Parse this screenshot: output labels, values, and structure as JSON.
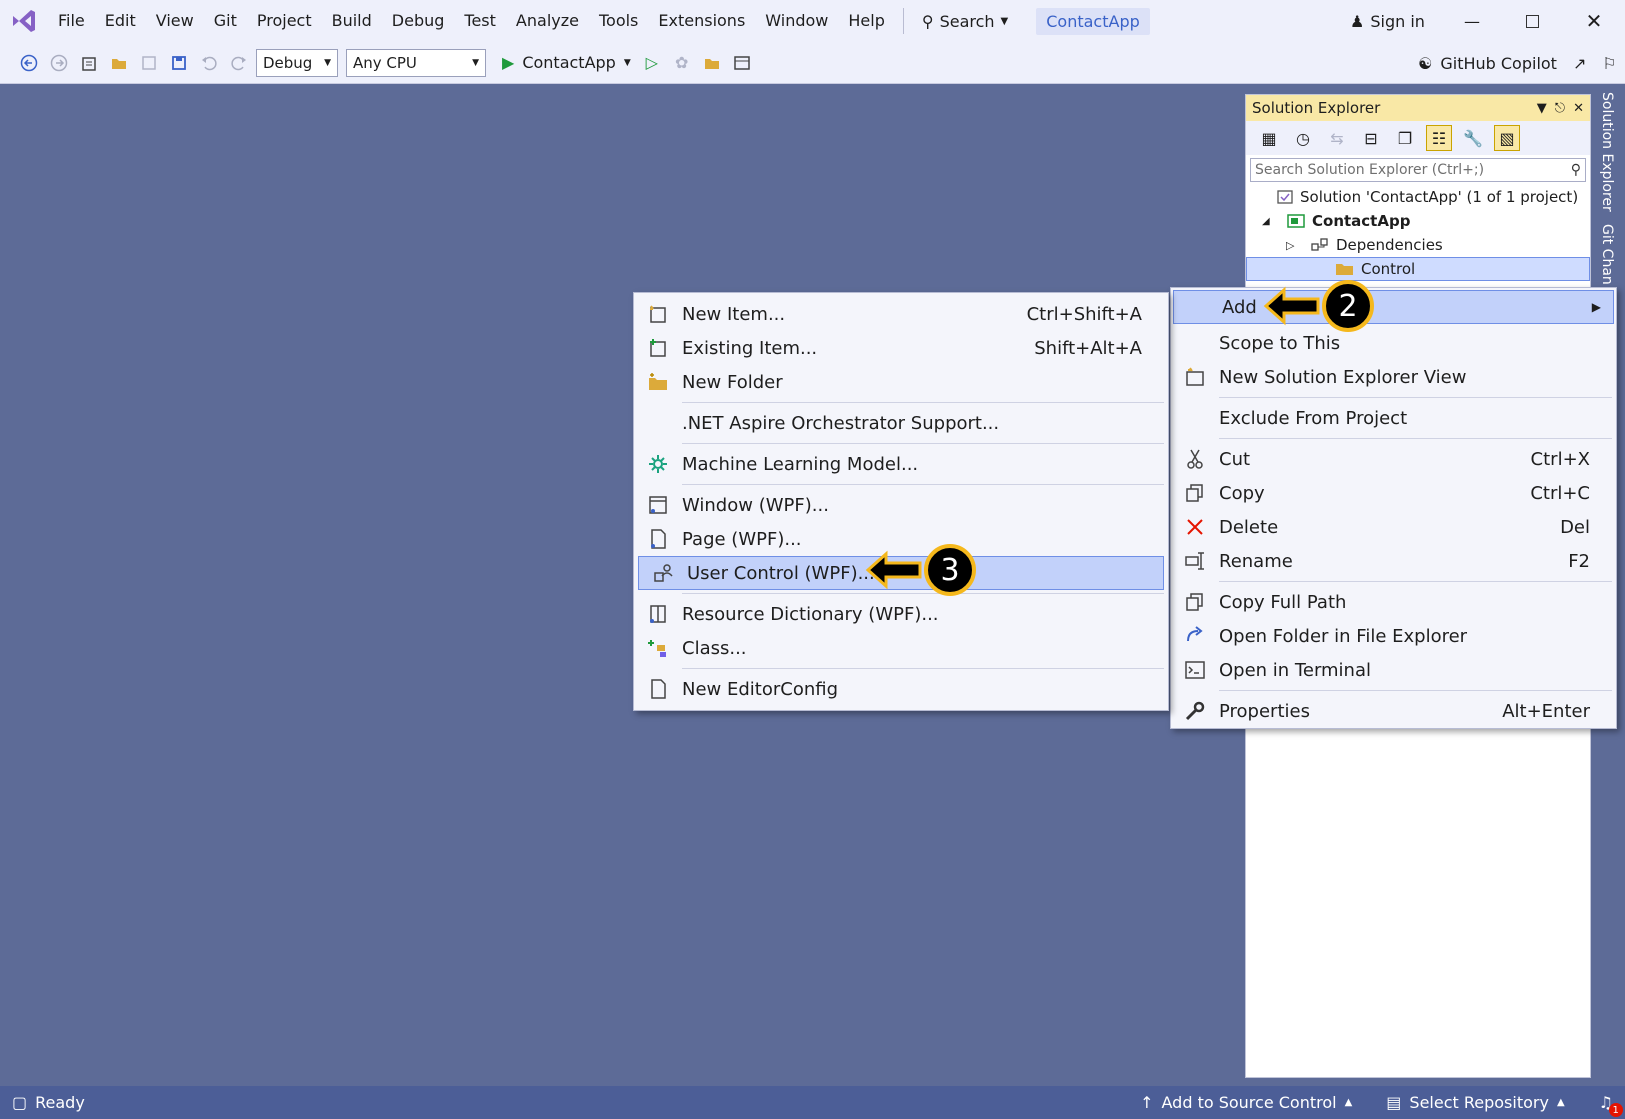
{
  "menubar": {
    "items": [
      "File",
      "Edit",
      "View",
      "Git",
      "Project",
      "Build",
      "Debug",
      "Test",
      "Analyze",
      "Tools",
      "Extensions",
      "Window",
      "Help"
    ],
    "search_label": "Search",
    "title": "ContactApp",
    "signin_label": "Sign in"
  },
  "toolbar": {
    "config": "Debug",
    "platform": "Any CPU",
    "run_label": "ContactApp",
    "copilot_label": "GitHub Copilot"
  },
  "solution_explorer": {
    "title": "Solution Explorer",
    "search_placeholder": "Search Solution Explorer (Ctrl+;)",
    "tree": [
      {
        "label": "Solution 'ContactApp' (1 of 1 project)",
        "depth": 0,
        "bold": false
      },
      {
        "label": "ContactApp",
        "depth": 1,
        "bold": true
      },
      {
        "label": "Dependencies",
        "depth": 2,
        "bold": false
      },
      {
        "label": "Control",
        "depth": 3,
        "bold": false
      }
    ]
  },
  "side_tabs": [
    "Solution Explorer",
    "Git Chan"
  ],
  "folder_menu": {
    "add": {
      "label": "Add",
      "highlighted": true
    },
    "items": [
      {
        "label": "Scope to This",
        "shortcut": "",
        "icon": "none"
      },
      {
        "label": "New Solution Explorer View",
        "shortcut": "",
        "icon": "new-view-icon"
      },
      {
        "sep": true
      },
      {
        "label": "Exclude From Project",
        "shortcut": "",
        "icon": "none"
      },
      {
        "sep": true
      },
      {
        "label": "Cut",
        "shortcut": "Ctrl+X",
        "icon": "scissors-icon"
      },
      {
        "label": "Copy",
        "shortcut": "Ctrl+C",
        "icon": "copy-icon"
      },
      {
        "label": "Delete",
        "shortcut": "Del",
        "icon": "delete-icon"
      },
      {
        "label": "Rename",
        "shortcut": "F2",
        "icon": "rename-icon"
      },
      {
        "sep": true
      },
      {
        "label": "Copy Full Path",
        "shortcut": "",
        "icon": "copy-icon"
      },
      {
        "label": "Open Folder in File Explorer",
        "shortcut": "",
        "icon": "open-folder-arrow-icon"
      },
      {
        "label": "Open in Terminal",
        "shortcut": "",
        "icon": "terminal-icon"
      },
      {
        "sep": true
      },
      {
        "label": "Properties",
        "shortcut": "Alt+Enter",
        "icon": "wrench-icon"
      }
    ]
  },
  "add_menu": {
    "items": [
      {
        "label": "New Item...",
        "shortcut": "Ctrl+Shift+A",
        "icon": "new-item-icon"
      },
      {
        "label": "Existing Item...",
        "shortcut": "Shift+Alt+A",
        "icon": "existing-item-icon"
      },
      {
        "label": "New Folder",
        "shortcut": "",
        "icon": "new-folder-icon"
      },
      {
        "sep": true
      },
      {
        "label": ".NET Aspire Orchestrator Support...",
        "shortcut": "",
        "icon": "none"
      },
      {
        "sep": true
      },
      {
        "label": "Machine Learning Model...",
        "shortcut": "",
        "icon": "ml-model-icon"
      },
      {
        "sep": true
      },
      {
        "label": "Window (WPF)...",
        "shortcut": "",
        "icon": "window-icon"
      },
      {
        "label": "Page (WPF)...",
        "shortcut": "",
        "icon": "page-icon"
      },
      {
        "label": "User Control (WPF)...",
        "shortcut": "",
        "icon": "user-control-icon",
        "highlighted": true
      },
      {
        "sep": true
      },
      {
        "label": "Resource Dictionary (WPF)...",
        "shortcut": "",
        "icon": "resource-dictionary-icon"
      },
      {
        "label": "Class...",
        "shortcut": "",
        "icon": "class-icon"
      },
      {
        "sep": true
      },
      {
        "label": "New EditorConfig",
        "shortcut": "",
        "icon": "file-icon"
      }
    ]
  },
  "callouts": {
    "step_add": "2",
    "step_user_control": "3"
  },
  "statusbar": {
    "ready": "Ready",
    "source_control": "Add to Source Control",
    "repository": "Select Repository",
    "notification_count": "1"
  },
  "colors": {
    "accent": "#7160e8",
    "highlight": "#c2d1fa",
    "callout": "#f5b81c",
    "status": "#4c5e97",
    "background": "#5d6b97"
  }
}
